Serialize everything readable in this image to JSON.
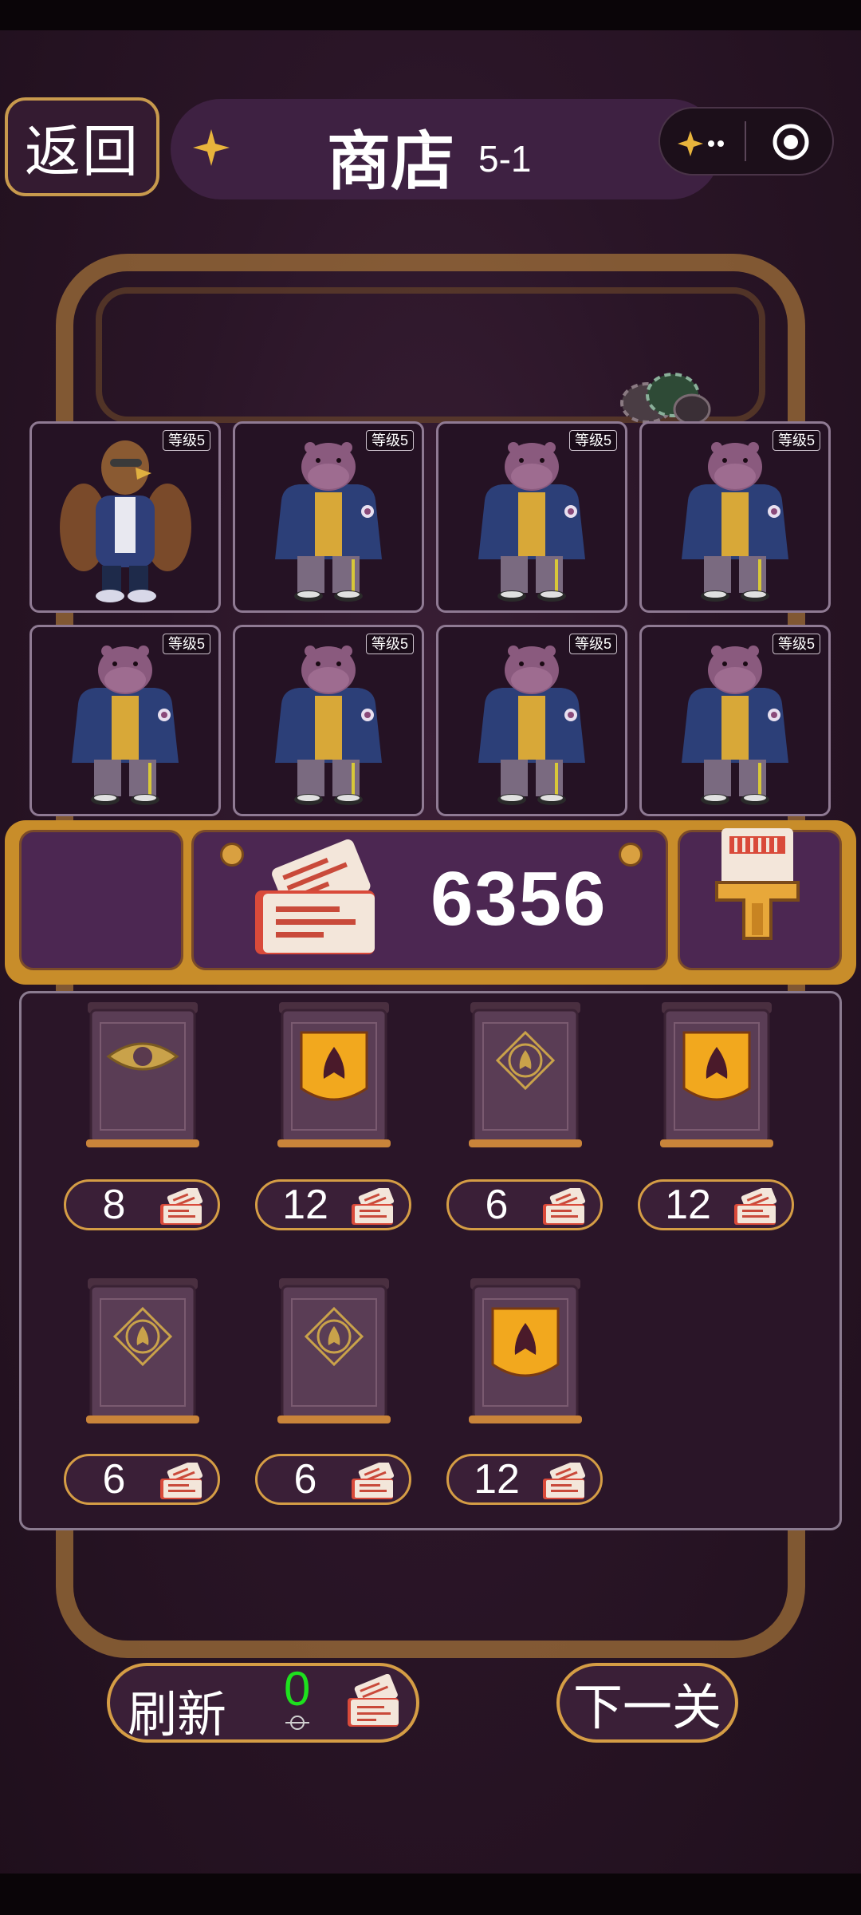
{
  "header": {
    "back_label": "返回",
    "title": "商店",
    "level": "5-1"
  },
  "characters": [
    {
      "type": "eagle",
      "level_label": "等级5"
    },
    {
      "type": "hippo",
      "level_label": "等级5"
    },
    {
      "type": "hippo",
      "level_label": "等级5"
    },
    {
      "type": "hippo",
      "level_label": "等级5"
    },
    {
      "type": "hippo",
      "level_label": "等级5"
    },
    {
      "type": "hippo",
      "level_label": "等级5"
    },
    {
      "type": "hippo",
      "level_label": "等级5"
    },
    {
      "type": "hippo",
      "level_label": "等级5"
    }
  ],
  "currency": {
    "amount": "6356",
    "icon": "ticket-icon"
  },
  "shop_items": [
    {
      "style": "plain-gold-emblem",
      "price": "8"
    },
    {
      "style": "gold-shield",
      "price": "12"
    },
    {
      "style": "plain-emblem",
      "price": "6"
    },
    {
      "style": "gold-shield",
      "price": "12"
    },
    {
      "style": "plain-emblem",
      "price": "6"
    },
    {
      "style": "plain-emblem",
      "price": "6"
    },
    {
      "style": "gold-shield",
      "price": "12"
    }
  ],
  "footer": {
    "refresh_label": "刷新",
    "refresh_cost": "0",
    "next_label": "下一关"
  },
  "colors": {
    "accent_gold": "#d59d45",
    "panel_purple": "#3a1f37",
    "free_cost_green": "#1ee01e"
  }
}
